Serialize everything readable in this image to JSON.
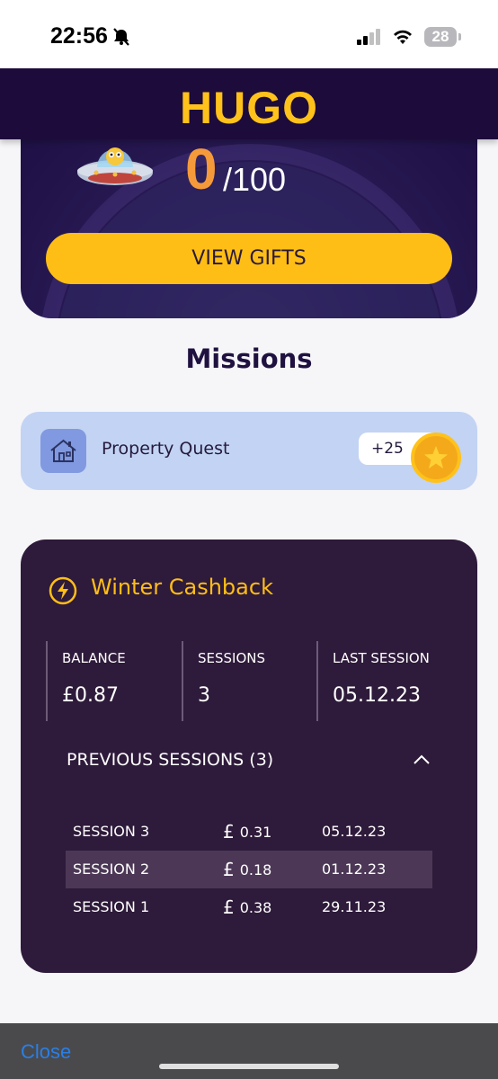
{
  "status_bar": {
    "time": "22:56",
    "battery": "28"
  },
  "header": {
    "logo": "HUGO"
  },
  "hero": {
    "points": "0",
    "points_max": "/100",
    "view_gifts_label": "VIEW GIFTS"
  },
  "missions": {
    "title": "Missions",
    "items": [
      {
        "label": "Property Quest",
        "reward": "+25"
      }
    ]
  },
  "cashback": {
    "title": "Winter Cashback",
    "stats": [
      {
        "label": "BALANCE",
        "value": "£0.87"
      },
      {
        "label": "SESSIONS",
        "value": "3"
      },
      {
        "label": "LAST SESSION",
        "value": "05.12.23"
      }
    ],
    "previous_sessions_label": "PREVIOUS SESSIONS (3)",
    "sessions": [
      {
        "name": "SESSION 3",
        "currency": "£",
        "amount": "0.31",
        "date": "05.12.23"
      },
      {
        "name": "SESSION 2",
        "currency": "£",
        "amount": "0.18",
        "date": "01.12.23"
      },
      {
        "name": "SESSION 1",
        "currency": "£",
        "amount": "0.38",
        "date": "29.11.23"
      }
    ]
  },
  "footer": {
    "close_label": "Close"
  },
  "colors": {
    "brand_yellow": "#ffbe16",
    "header_bg": "#1d0b3b",
    "cashback_bg": "#2e1a3a",
    "mission_bg": "#c3d3f3",
    "points_orange": "#f59a3a",
    "close_blue": "#2a7fe6"
  }
}
